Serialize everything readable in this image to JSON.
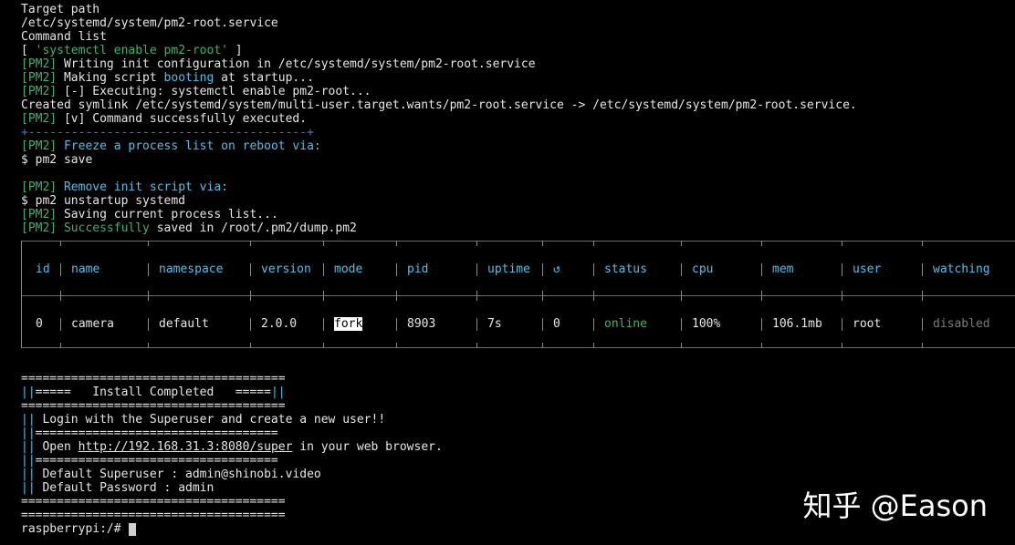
{
  "terminal": {
    "lines": {
      "l1": "Target path",
      "l2": "/etc/systemd/system/pm2-root.service",
      "l3": "Command list",
      "l4_open": "[ ",
      "l4_cmd": "'systemctl enable pm2-root'",
      "l4_close": " ]",
      "tag": "[PM2]",
      "l5": " Writing init configuration in /etc/systemd/system/pm2-root.service",
      "l6a": " Making script ",
      "l6b": "booting",
      "l6c": " at startup...",
      "l7": " [-] Executing: systemctl enable pm2-root...",
      "l8": "Created symlink /etc/systemd/system/multi-user.target.wants/pm2-root.service -> /etc/systemd/system/pm2-root.service.",
      "l9": " [v] Command successfully executed.",
      "l10": "+---------------------------------------+",
      "l11": " Freeze a process list on reboot via:",
      "l12": "$ pm2 save",
      "l13": " Remove init script via:",
      "l14": "$ pm2 unstartup systemd",
      "l15": " Saving current process list...",
      "l16a": " Successfully",
      "l16b": " saved in /root/.pm2/dump.pm2"
    },
    "table": {
      "headers": [
        "id",
        "name",
        "namespace",
        "version",
        "mode",
        "pid",
        "uptime",
        "↺",
        "status",
        "cpu",
        "mem",
        "user",
        "watching"
      ],
      "rows": [
        [
          "0",
          "camera",
          "default",
          "2.0.0",
          "fork",
          "8903",
          "7s",
          "0",
          "online",
          "100%",
          "106.1mb",
          "root",
          "disabled"
        ]
      ]
    },
    "banner": {
      "rule": "=====================================",
      "title_pre": "||=====",
      "title": "   Install Completed   ",
      "title_post": "=====||",
      "bar": "||",
      "login": " Login with the Superuser and create a new user!!",
      "sub_rule": "||==================================",
      "open_pre": " Open ",
      "url": "http://192.168.31.3:8080/super",
      "open_post": " in your web browser.",
      "superuser": " Default Superuser : admin@shinobi.video",
      "password": " Default Password : admin"
    },
    "prompt": "raspberrypi:/#"
  },
  "watermark": "知乎 @Eason",
  "colors": {
    "background": "#000000",
    "green": "#3cb371",
    "cyan": "#4fc1e9",
    "text": "#e6e6e6",
    "dim": "#7a7a7a"
  }
}
